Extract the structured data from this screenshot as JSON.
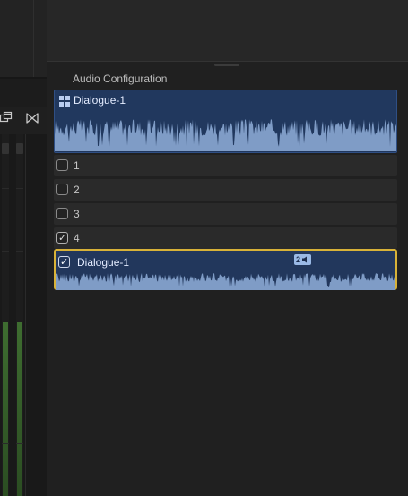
{
  "panel": {
    "title": "Audio Configuration"
  },
  "main_clip": {
    "name": "Dialogue-1",
    "icon": "grid-icon"
  },
  "channels": [
    {
      "label": "1",
      "checked": false
    },
    {
      "label": "2",
      "checked": false
    },
    {
      "label": "3",
      "checked": false
    },
    {
      "label": "4",
      "checked": true
    }
  ],
  "selected_clip": {
    "name": "Dialogue-1",
    "checked": true,
    "channel_badge": "2",
    "badge_icon": "speaker-icon"
  },
  "colors": {
    "clip_fill": "#21385e",
    "waveform": "#7f9cc6",
    "selection_border": "#d8b238",
    "meter_level": "#3e6d30"
  },
  "left_toolbar": {
    "icons": [
      "duplicate-window-icon",
      "bowtie-icon"
    ]
  }
}
